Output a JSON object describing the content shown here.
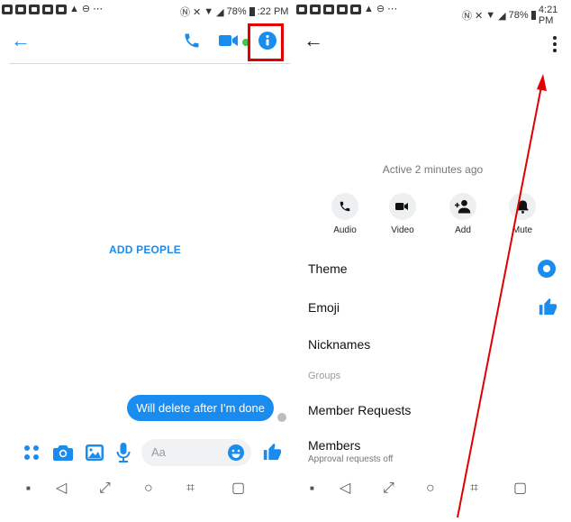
{
  "left": {
    "status": {
      "battery": "78%",
      "time": ":22 PM"
    },
    "add_people": "ADD PEOPLE",
    "message": "Will delete after I'm done",
    "composer": {
      "placeholder": "Aa"
    }
  },
  "right": {
    "status": {
      "battery": "78%",
      "time": "4:21 PM"
    },
    "active_status": "Active 2 minutes ago",
    "actions": [
      {
        "label": "Audio",
        "icon": "phone-icon"
      },
      {
        "label": "Video",
        "icon": "video-icon"
      },
      {
        "label": "Add",
        "icon": "add-person-icon"
      },
      {
        "label": "Mute",
        "icon": "bell-icon"
      }
    ],
    "settings": {
      "theme": "Theme",
      "emoji": "Emoji",
      "nicknames": "Nicknames",
      "groups_header": "Groups",
      "member_requests": "Member Requests",
      "members": "Members",
      "members_sub": "Approval requests off"
    }
  },
  "colors": {
    "accent": "#1a8cf0",
    "annotation": "#e00000"
  }
}
